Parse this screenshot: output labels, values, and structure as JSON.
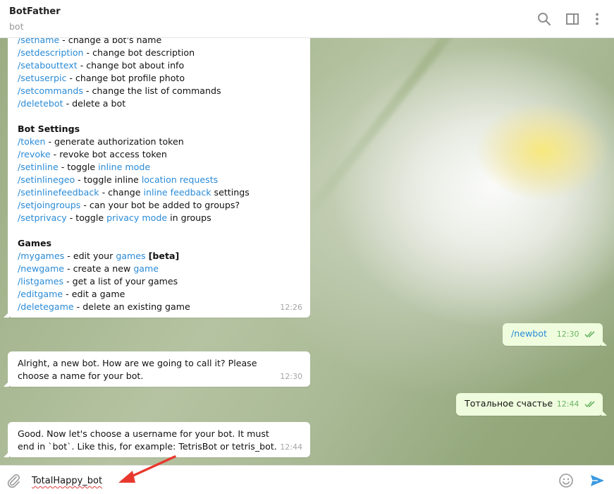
{
  "header": {
    "title": "BotFather",
    "subtitle": "bot",
    "icons": [
      "search-icon",
      "sidebar-toggle-icon",
      "more-vertical-icon"
    ]
  },
  "messages": [
    {
      "direction": "incoming",
      "time": "12:26",
      "lines": [
        {
          "cmd": "/setname",
          "text": " - change a bot's name"
        },
        {
          "cmd": "/setdescription",
          "text": " - change bot description"
        },
        {
          "cmd": "/setabouttext",
          "text": " - change bot about info"
        },
        {
          "cmd": "/setuserpic",
          "text": " - change bot profile photo"
        },
        {
          "cmd": "/setcommands",
          "text": " - change the list of commands"
        },
        {
          "cmd": "/deletebot",
          "text": " - delete a bot"
        }
      ],
      "sections": [
        {
          "title": "Bot Settings",
          "lines": [
            {
              "cmd": "/token",
              "text": " - generate authorization token"
            },
            {
              "cmd": "/revoke",
              "text": " - revoke bot access token"
            },
            {
              "cmd": "/setinline",
              "text": " - toggle ",
              "link": "inline mode",
              "after": ""
            },
            {
              "cmd": "/setinlinegeo",
              "text": " - toggle inline ",
              "link": "location requests",
              "after": ""
            },
            {
              "cmd": "/setinlinefeedback",
              "text": " - change ",
              "link": "inline feedback",
              "after": " settings"
            },
            {
              "cmd": "/setjoingroups",
              "text": " - can your bot be added to groups?"
            },
            {
              "cmd": "/setprivacy",
              "text": " - toggle ",
              "link": "privacy mode",
              "after": " in groups"
            }
          ]
        },
        {
          "title": "Games",
          "lines": [
            {
              "cmd": "/mygames",
              "text": " - edit your ",
              "link": "games",
              "after": " ",
              "bold_after": "[beta]"
            },
            {
              "cmd": "/newgame",
              "text": " - create a new ",
              "link": "game",
              "after": ""
            },
            {
              "cmd": "/listgames",
              "text": " - get a list of your games"
            },
            {
              "cmd": "/editgame",
              "text": " - edit a game"
            },
            {
              "cmd": "/deletegame",
              "text": " - delete an existing game"
            }
          ]
        }
      ]
    },
    {
      "direction": "outgoing",
      "cmd": "/newbot",
      "time": "12:30",
      "read": true
    },
    {
      "direction": "incoming",
      "text": "Alright, a new bot. How are we going to call it? Please choose a name for your bot.",
      "time": "12:30"
    },
    {
      "direction": "outgoing",
      "text": "Тотальное счастье",
      "time": "12:44",
      "read": true
    },
    {
      "direction": "incoming",
      "text": "Good. Now let's choose a username for your bot. It must end in `bot`. Like this, for example: TetrisBot or tetris_bot.",
      "time": "12:44"
    }
  ],
  "composer": {
    "value": "TotalHappy_bot",
    "icons": [
      "attach-icon",
      "emoji-icon",
      "send-icon"
    ]
  },
  "colors": {
    "link": "#2a8bd6",
    "outgoing_bubble": "#effdde",
    "read_ticks": "#6cb365",
    "send": "#3a9ae0",
    "annotation_arrow": "#e8382e"
  }
}
